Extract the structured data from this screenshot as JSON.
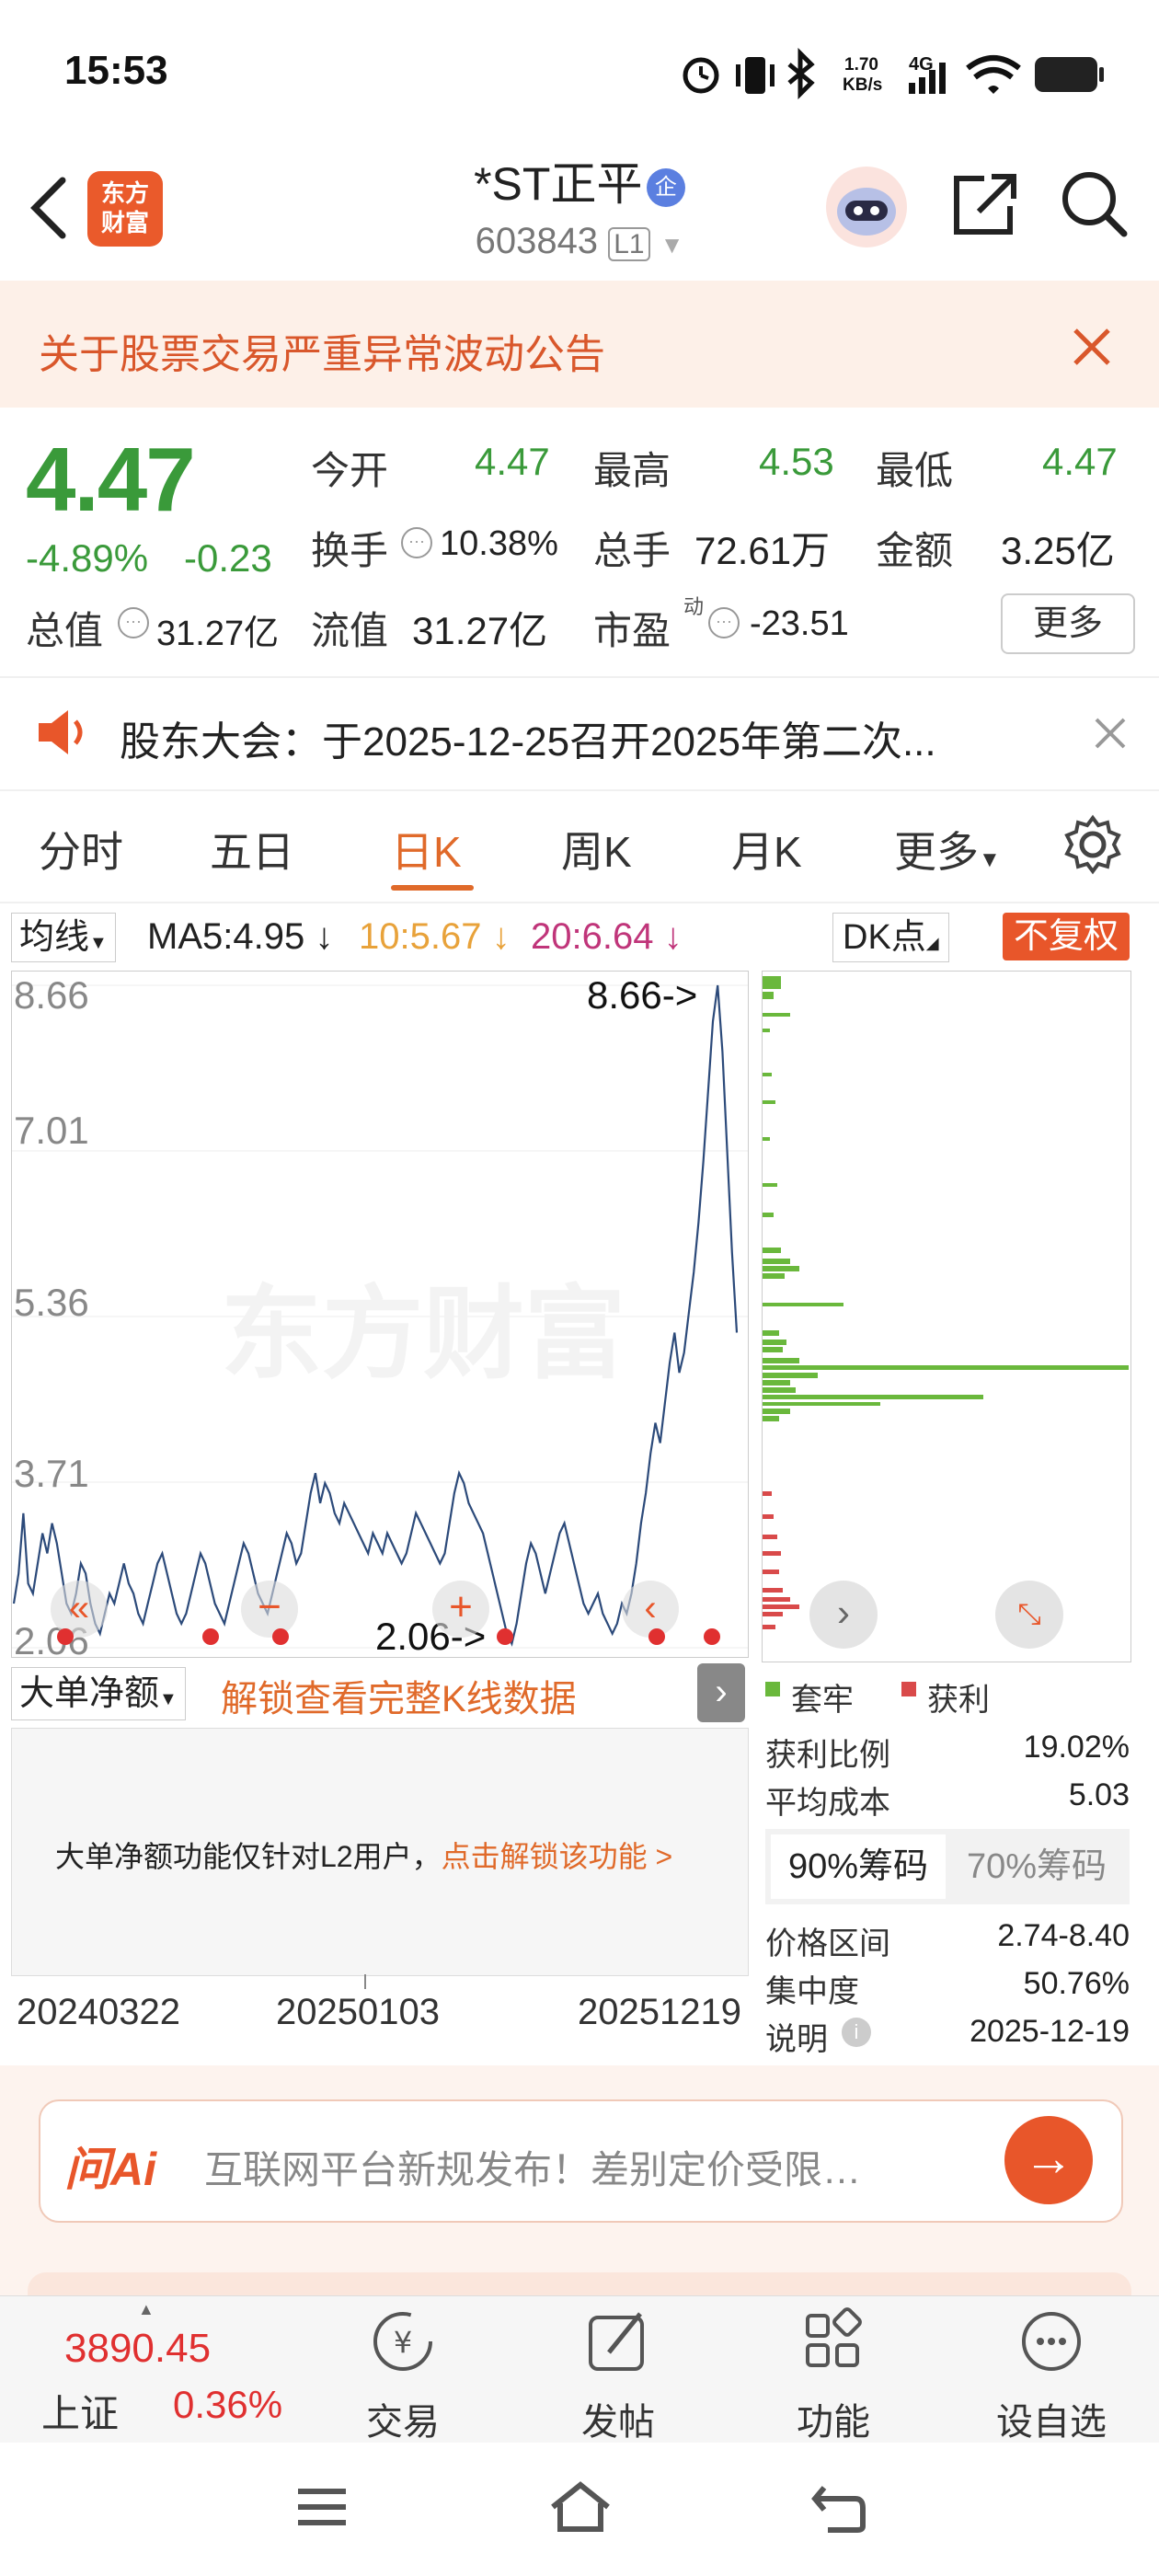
{
  "status_bar": {
    "time": "15:53",
    "net_speed": "1.70\nKB/s",
    "network": "4G"
  },
  "header": {
    "stock_name": "*ST正平",
    "badge": "企",
    "code": "603843",
    "level": "L1",
    "logo_text": "东方\n财富"
  },
  "notice": {
    "text": "关于股票交易严重异常波动公告"
  },
  "quote": {
    "price": "4.47",
    "change_pct": "-4.89%",
    "change_amt": "-0.23",
    "open_label": "今开",
    "open": "4.47",
    "high_label": "最高",
    "high": "4.53",
    "low_label": "最低",
    "low": "4.47",
    "turnover_label": "换手",
    "turnover": "10.38%",
    "volume_label": "总手",
    "volume": "72.61万",
    "amount_label": "金额",
    "amount": "3.25亿",
    "mktcap_label": "总值",
    "mktcap": "31.27亿",
    "float_label": "流值",
    "float": "31.27亿",
    "pe_label": "市盈",
    "pe_sup": "动",
    "pe": "-23.51",
    "more": "更多"
  },
  "announcement": {
    "text": "股东大会：于2025-12-25召开2025年第二次..."
  },
  "tabs": [
    {
      "label": "分时"
    },
    {
      "label": "五日"
    },
    {
      "label": "日K"
    },
    {
      "label": "周K"
    },
    {
      "label": "月K"
    },
    {
      "label": "更多"
    }
  ],
  "chart_toolbar": {
    "ma_select": "均线",
    "ma5": "MA5:4.95 ↓",
    "ma10": "10:5.67 ↓",
    "ma20": "20:6.64 ↓",
    "dk": "DK点",
    "fq": "不复权",
    "ma5_color": "#222222",
    "ma10_color": "#e8a23a",
    "ma20_color": "#c0357a"
  },
  "chart_data": {
    "type": "line",
    "yticks": [
      "8.66",
      "7.01",
      "5.36",
      "3.71",
      "2.06"
    ],
    "ylim": [
      2.06,
      8.66
    ],
    "max_label": "8.66->",
    "min_label": "2.06->",
    "x_ticks": [
      "20240322",
      "20250103",
      "20251219"
    ],
    "watermark": "东方财富",
    "series": [
      {
        "values": [
          2.5,
          2.8,
          3.4,
          2.7,
          2.6,
          2.9,
          3.2,
          3.0,
          3.3,
          3.1,
          2.8,
          2.5,
          2.4,
          2.6,
          2.9,
          2.8,
          2.5,
          2.3,
          2.2,
          2.4,
          2.6,
          2.5,
          2.7,
          2.9,
          2.7,
          2.6,
          2.4,
          2.3,
          2.5,
          2.7,
          2.9,
          3.0,
          2.8,
          2.6,
          2.4,
          2.3,
          2.4,
          2.6,
          2.8,
          3.0,
          2.9,
          2.7,
          2.5,
          2.4,
          2.3,
          2.5,
          2.7,
          2.9,
          3.1,
          3.0,
          2.8,
          2.6,
          2.5,
          2.4,
          2.6,
          2.8,
          3.0,
          3.2,
          3.1,
          2.9,
          3.0,
          3.3,
          3.6,
          3.8,
          3.5,
          3.7,
          3.6,
          3.4,
          3.3,
          3.5,
          3.4,
          3.3,
          3.2,
          3.1,
          3.0,
          3.2,
          3.1,
          3.0,
          3.2,
          3.1,
          3.0,
          2.9,
          3.0,
          3.2,
          3.4,
          3.3,
          3.2,
          3.1,
          3.0,
          2.9,
          3.0,
          3.3,
          3.6,
          3.8,
          3.7,
          3.5,
          3.4,
          3.3,
          3.2,
          3.0,
          2.8,
          2.6,
          2.4,
          2.2,
          2.1,
          2.3,
          2.6,
          2.9,
          3.1,
          3.0,
          2.8,
          2.6,
          2.8,
          3.0,
          3.2,
          3.3,
          3.1,
          2.9,
          2.7,
          2.5,
          2.4,
          2.5,
          2.6,
          2.4,
          2.3,
          2.2,
          2.3,
          2.5,
          2.4,
          2.6,
          2.9,
          3.3,
          3.6,
          4.0,
          4.3,
          4.1,
          4.5,
          4.9,
          5.2,
          4.8,
          5.0,
          5.4,
          5.8,
          6.3,
          6.9,
          7.6,
          8.3,
          8.66,
          8.0,
          7.0,
          6.0,
          5.2
        ]
      }
    ]
  },
  "distribution": {
    "legend_trapped": "套牢",
    "legend_profit": "获利",
    "trapped_color": "#6ab83c",
    "profit_color": "#d94a4a",
    "profit_ratio_label": "获利比例",
    "profit_ratio": "19.02%",
    "avg_cost_label": "平均成本",
    "avg_cost": "5.03",
    "tab90": "90%筹码",
    "tab70": "70%筹码",
    "price_range_label": "价格区间",
    "price_range": "2.74-8.40",
    "concentration_label": "集中度",
    "concentration": "50.76%",
    "note_label": "说明",
    "note_date": "2025-12-19"
  },
  "indicator": {
    "select": "大单净额",
    "unlock_text": "解锁查看完整K线数据",
    "l2_text": "大单净额功能仅针对L2用户，",
    "l2_link": "点击解锁该功能 >"
  },
  "ai_bar": {
    "logo": "问Ai",
    "text": "互联网平台新规发布！差别定价受限…"
  },
  "bottom_nav": {
    "index_value": "3890.45",
    "index_name": "上证",
    "index_change": "0.36%",
    "items": [
      {
        "label": "交易"
      },
      {
        "label": "发帖"
      },
      {
        "label": "功能"
      },
      {
        "label": "设自选"
      }
    ]
  }
}
